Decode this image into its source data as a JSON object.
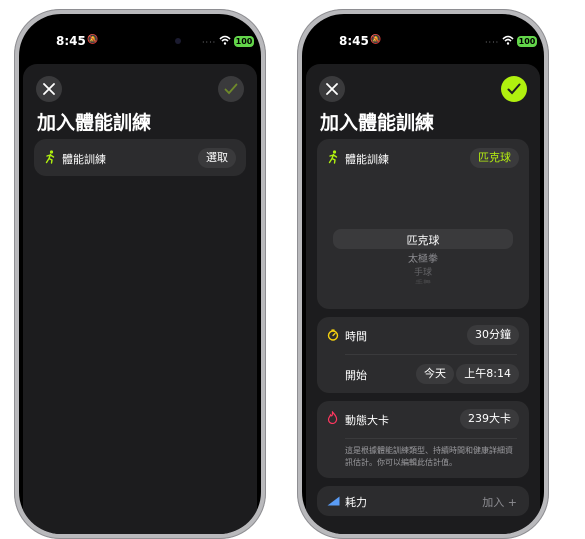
{
  "left": {
    "status": {
      "time": "8:45",
      "battery": "100"
    },
    "title": "加入體能訓練",
    "workout_row": {
      "label": "體能訓練",
      "button": "選取"
    }
  },
  "right": {
    "status": {
      "time": "8:45",
      "battery": "100"
    },
    "title": "加入體能訓練",
    "workout_row": {
      "label": "體能訓練",
      "value": "匹克球"
    },
    "picker": {
      "items": [
        "匹克球",
        "太極拳",
        "手球",
        "手舞"
      ]
    },
    "time_card": {
      "time_label": "時間",
      "duration": "30分鐘",
      "start_label": "開始",
      "start_day": "今天",
      "start_time": "上午8:14"
    },
    "calories_card": {
      "label": "動態大卡",
      "value": "239大卡",
      "note": "這是根據體能訓練類型、持續時間和健康詳細資訊估計。你可以編輯此估計值。"
    },
    "effort_row": {
      "label": "耗力",
      "add": "加入 +"
    }
  },
  "colors": {
    "accent": "#b0f00f",
    "battery": "#63d54a",
    "sheet": "#1c1c1e",
    "card": "#2c2c2e"
  }
}
